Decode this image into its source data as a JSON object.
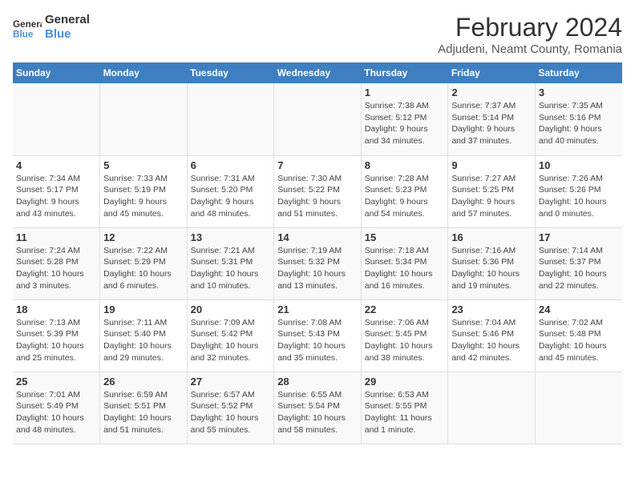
{
  "header": {
    "logo_line1": "General",
    "logo_line2": "Blue",
    "title": "February 2024",
    "subtitle": "Adjudeni, Neamt County, Romania"
  },
  "days_of_week": [
    "Sunday",
    "Monday",
    "Tuesday",
    "Wednesday",
    "Thursday",
    "Friday",
    "Saturday"
  ],
  "weeks": [
    [
      {
        "day": "",
        "content": ""
      },
      {
        "day": "",
        "content": ""
      },
      {
        "day": "",
        "content": ""
      },
      {
        "day": "",
        "content": ""
      },
      {
        "day": "1",
        "content": "Sunrise: 7:38 AM\nSunset: 5:12 PM\nDaylight: 9 hours\nand 34 minutes."
      },
      {
        "day": "2",
        "content": "Sunrise: 7:37 AM\nSunset: 5:14 PM\nDaylight: 9 hours\nand 37 minutes."
      },
      {
        "day": "3",
        "content": "Sunrise: 7:35 AM\nSunset: 5:16 PM\nDaylight: 9 hours\nand 40 minutes."
      }
    ],
    [
      {
        "day": "4",
        "content": "Sunrise: 7:34 AM\nSunset: 5:17 PM\nDaylight: 9 hours\nand 43 minutes."
      },
      {
        "day": "5",
        "content": "Sunrise: 7:33 AM\nSunset: 5:19 PM\nDaylight: 9 hours\nand 45 minutes."
      },
      {
        "day": "6",
        "content": "Sunrise: 7:31 AM\nSunset: 5:20 PM\nDaylight: 9 hours\nand 48 minutes."
      },
      {
        "day": "7",
        "content": "Sunrise: 7:30 AM\nSunset: 5:22 PM\nDaylight: 9 hours\nand 51 minutes."
      },
      {
        "day": "8",
        "content": "Sunrise: 7:28 AM\nSunset: 5:23 PM\nDaylight: 9 hours\nand 54 minutes."
      },
      {
        "day": "9",
        "content": "Sunrise: 7:27 AM\nSunset: 5:25 PM\nDaylight: 9 hours\nand 57 minutes."
      },
      {
        "day": "10",
        "content": "Sunrise: 7:26 AM\nSunset: 5:26 PM\nDaylight: 10 hours\nand 0 minutes."
      }
    ],
    [
      {
        "day": "11",
        "content": "Sunrise: 7:24 AM\nSunset: 5:28 PM\nDaylight: 10 hours\nand 3 minutes."
      },
      {
        "day": "12",
        "content": "Sunrise: 7:22 AM\nSunset: 5:29 PM\nDaylight: 10 hours\nand 6 minutes."
      },
      {
        "day": "13",
        "content": "Sunrise: 7:21 AM\nSunset: 5:31 PM\nDaylight: 10 hours\nand 10 minutes."
      },
      {
        "day": "14",
        "content": "Sunrise: 7:19 AM\nSunset: 5:32 PM\nDaylight: 10 hours\nand 13 minutes."
      },
      {
        "day": "15",
        "content": "Sunrise: 7:18 AM\nSunset: 5:34 PM\nDaylight: 10 hours\nand 16 minutes."
      },
      {
        "day": "16",
        "content": "Sunrise: 7:16 AM\nSunset: 5:36 PM\nDaylight: 10 hours\nand 19 minutes."
      },
      {
        "day": "17",
        "content": "Sunrise: 7:14 AM\nSunset: 5:37 PM\nDaylight: 10 hours\nand 22 minutes."
      }
    ],
    [
      {
        "day": "18",
        "content": "Sunrise: 7:13 AM\nSunset: 5:39 PM\nDaylight: 10 hours\nand 25 minutes."
      },
      {
        "day": "19",
        "content": "Sunrise: 7:11 AM\nSunset: 5:40 PM\nDaylight: 10 hours\nand 29 minutes."
      },
      {
        "day": "20",
        "content": "Sunrise: 7:09 AM\nSunset: 5:42 PM\nDaylight: 10 hours\nand 32 minutes."
      },
      {
        "day": "21",
        "content": "Sunrise: 7:08 AM\nSunset: 5:43 PM\nDaylight: 10 hours\nand 35 minutes."
      },
      {
        "day": "22",
        "content": "Sunrise: 7:06 AM\nSunset: 5:45 PM\nDaylight: 10 hours\nand 38 minutes."
      },
      {
        "day": "23",
        "content": "Sunrise: 7:04 AM\nSunset: 5:46 PM\nDaylight: 10 hours\nand 42 minutes."
      },
      {
        "day": "24",
        "content": "Sunrise: 7:02 AM\nSunset: 5:48 PM\nDaylight: 10 hours\nand 45 minutes."
      }
    ],
    [
      {
        "day": "25",
        "content": "Sunrise: 7:01 AM\nSunset: 5:49 PM\nDaylight: 10 hours\nand 48 minutes."
      },
      {
        "day": "26",
        "content": "Sunrise: 6:59 AM\nSunset: 5:51 PM\nDaylight: 10 hours\nand 51 minutes."
      },
      {
        "day": "27",
        "content": "Sunrise: 6:57 AM\nSunset: 5:52 PM\nDaylight: 10 hours\nand 55 minutes."
      },
      {
        "day": "28",
        "content": "Sunrise: 6:55 AM\nSunset: 5:54 PM\nDaylight: 10 hours\nand 58 minutes."
      },
      {
        "day": "29",
        "content": "Sunrise: 6:53 AM\nSunset: 5:55 PM\nDaylight: 11 hours\nand 1 minute."
      },
      {
        "day": "",
        "content": ""
      },
      {
        "day": "",
        "content": ""
      }
    ]
  ]
}
